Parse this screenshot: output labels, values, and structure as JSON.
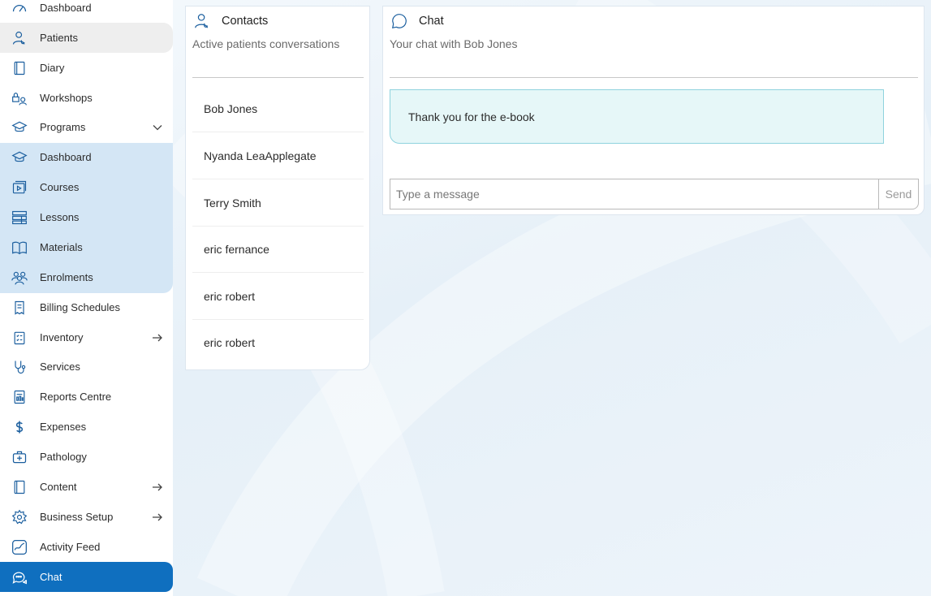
{
  "sidebar": {
    "items": [
      {
        "label": "Dashboard",
        "icon": "gauge-icon"
      },
      {
        "label": "Patients",
        "icon": "user-stethoscope-icon"
      },
      {
        "label": "Diary",
        "icon": "notebook-icon"
      },
      {
        "label": "Workshops",
        "icon": "group-lock-icon"
      },
      {
        "label": "Programs",
        "icon": "graduation-cap-icon"
      },
      {
        "label": "Dashboard",
        "icon": "graduation-cap-icon"
      },
      {
        "label": "Courses",
        "icon": "video-course-icon"
      },
      {
        "label": "Lessons",
        "icon": "lesson-stack-icon"
      },
      {
        "label": "Materials",
        "icon": "open-book-icon"
      },
      {
        "label": "Enrolments",
        "icon": "people-icon"
      },
      {
        "label": "Billing Schedules",
        "icon": "billing-receipt-icon"
      },
      {
        "label": "Inventory",
        "icon": "checklist-icon"
      },
      {
        "label": "Services",
        "icon": "stethoscope-icon"
      },
      {
        "label": "Reports Centre",
        "icon": "report-icon"
      },
      {
        "label": "Expenses",
        "icon": "dollar-icon"
      },
      {
        "label": "Pathology",
        "icon": "medical-kit-icon"
      },
      {
        "label": "Content",
        "icon": "book-icon"
      },
      {
        "label": "Business Setup",
        "icon": "gear-icon"
      },
      {
        "label": "Activity Feed",
        "icon": "activity-chart-icon"
      },
      {
        "label": "Chat",
        "icon": "chat-bubbles-icon"
      }
    ]
  },
  "contacts": {
    "title": "Contacts",
    "subtitle": "Active patients conversations",
    "list": [
      "Bob Jones",
      "Nyanda LeaApplegate",
      "Terry Smith",
      "eric fernance",
      "eric robert",
      "eric robert"
    ]
  },
  "chat": {
    "title": "Chat",
    "subtitle": "Your chat with Bob Jones",
    "messages": [
      "Thank you for the e-book"
    ],
    "input_placeholder": "Type a message",
    "send_label": "Send"
  },
  "colors": {
    "accent": "#0f6fbf",
    "sub_group_bg": "#d4e6f5",
    "bubble_bg": "#e6f7f8",
    "bubble_border": "#8fd3de"
  }
}
